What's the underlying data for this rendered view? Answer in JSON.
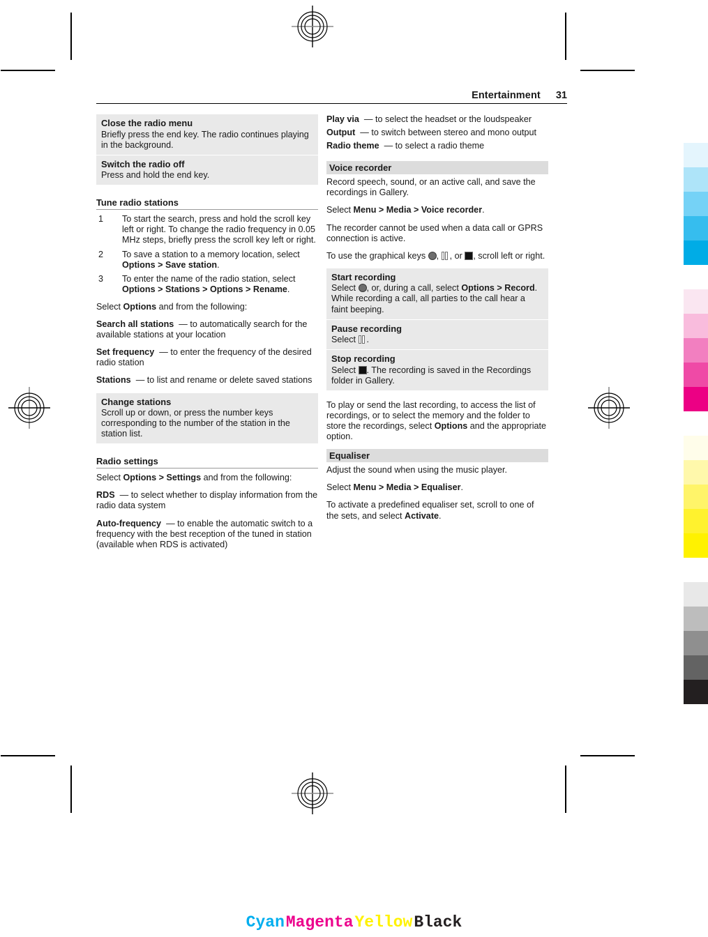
{
  "header": {
    "title": "Entertainment",
    "page_number": "31"
  },
  "left_column": {
    "panel_group_1": [
      {
        "heading": "Close the radio menu",
        "body": "Briefly press the end key. The radio continues playing in the background."
      },
      {
        "heading": "Switch the radio off",
        "body": "Press and hold the end key."
      }
    ],
    "section_tune": {
      "title": "Tune radio stations",
      "steps": [
        {
          "n": "1",
          "text_1": "To start the search, press and hold the scroll key left or right. To change the radio frequency in 0.05 MHz steps, briefly press the scroll key left or right."
        },
        {
          "n": "2",
          "pre": "To save a station to a memory location, select ",
          "b1": "Options",
          "sep1": " > ",
          "b2": "Save station",
          "post": "."
        },
        {
          "n": "3",
          "pre": "To enter the name of the radio station, select ",
          "b1": "Options",
          "sep1": " > ",
          "b2": "Stations",
          "sep2": " > ",
          "b3": "Options",
          "sep3": " > ",
          "b4": "Rename",
          "post": "."
        }
      ],
      "intro_pre": "Select ",
      "intro_bold": "Options",
      "intro_post": " and from the following:",
      "options": [
        {
          "term": "Search all stations",
          "dash": "—",
          "desc": "to automatically search for the available stations at your location"
        },
        {
          "term": "Set frequency",
          "dash": "—",
          "desc": "to enter the frequency of the desired radio station"
        },
        {
          "term": "Stations",
          "dash": "—",
          "desc": "to list and rename or delete saved stations"
        }
      ]
    },
    "panel_change_stations": {
      "heading": "Change stations",
      "body": "Scroll up or down, or press the number keys corresponding to the number of the station in the station list."
    },
    "section_radio_settings": {
      "title": "Radio settings",
      "intro_pre": "Select ",
      "intro_b1": "Options",
      "intro_sep": " > ",
      "intro_b2": "Settings",
      "intro_post": " and from the following:",
      "options": [
        {
          "term": "RDS",
          "dash": "—",
          "desc": "to select whether to display information from the radio data system"
        },
        {
          "term": "Auto-frequency",
          "dash": "—",
          "desc": "to enable the automatic switch to a frequency with the best reception of the tuned in station (available when RDS is activated)"
        }
      ]
    }
  },
  "right_column": {
    "options_top": [
      {
        "term": "Play via",
        "dash": "—",
        "desc": "to select the headset or the loudspeaker"
      },
      {
        "term": "Output",
        "dash": "—",
        "desc": "to switch between stereo and mono output"
      },
      {
        "term": "Radio theme",
        "dash": "—",
        "desc": "to select a radio theme"
      }
    ],
    "voice_recorder": {
      "bar_heading": "Voice recorder",
      "intro": "Record speech, sound, or an active call, and save the recordings in Gallery.",
      "path_pre": "Select ",
      "path_b1": "Menu",
      "path_sep1": " > ",
      "path_b2": "Media",
      "path_sep2": " > ",
      "path_b3": "Voice recorder",
      "path_post": ".",
      "note": "The recorder cannot be used when a data call or GPRS connection is active.",
      "keys_pre": "To use the graphical keys ",
      "keys_sep1": ", ",
      "keys_sep2": ", or ",
      "keys_post": ", scroll left or right.",
      "panels": [
        {
          "heading": "Start recording",
          "pre": "Select ",
          "mid": ", or, during a call, select ",
          "b1": "Options",
          "sep1": " > ",
          "b2": "Record",
          "post": ". While recording a call, all parties to the call hear a faint beeping."
        },
        {
          "heading": "Pause recording",
          "pre": "Select ",
          "post": "."
        },
        {
          "heading": "Stop recording",
          "pre": "Select ",
          "post": ". The recording is saved in the Recordings folder in Gallery."
        }
      ],
      "outro_pre": "To play or send the last recording, to access the list of recordings, or to select the memory and the folder to store the recordings, select ",
      "outro_bold": "Options",
      "outro_post": " and the appropriate option."
    },
    "equaliser": {
      "bar_heading": "Equaliser",
      "intro": "Adjust the sound when using the music player.",
      "path_pre": "Select ",
      "path_b1": "Menu",
      "path_sep1": " > ",
      "path_b2": "Media",
      "path_sep2": " > ",
      "path_b3": "Equaliser",
      "path_post": ".",
      "activate_pre": "To activate a predefined equaliser set, scroll to one of the sets, and select ",
      "activate_bold": "Activate",
      "activate_post": "."
    }
  },
  "print_marks": {
    "cmyk_labels": [
      {
        "text": "Cyan",
        "color": "#00AEEF"
      },
      {
        "text": "Magenta",
        "color": "#EC008C"
      },
      {
        "text": "Yellow",
        "color": "#FFF200"
      },
      {
        "text": "Black",
        "color": "#231F20"
      }
    ],
    "color_strip": {
      "cyan": [
        "#e4f5fd",
        "#aee4f9",
        "#75d2f6",
        "#36bdee",
        "#00ace6"
      ],
      "magenta": [
        "#fae6f1",
        "#f9bcdd",
        "#f27fc0",
        "#ef4aa6",
        "#ec0084"
      ],
      "yellow": [
        "#fffdea",
        "#fff8ab",
        "#fff469",
        "#fff22e",
        "#fff200"
      ],
      "black": [
        "#e8e8e8",
        "#bdbdbd",
        "#8f8f8f",
        "#636363",
        "#231f20"
      ]
    }
  }
}
